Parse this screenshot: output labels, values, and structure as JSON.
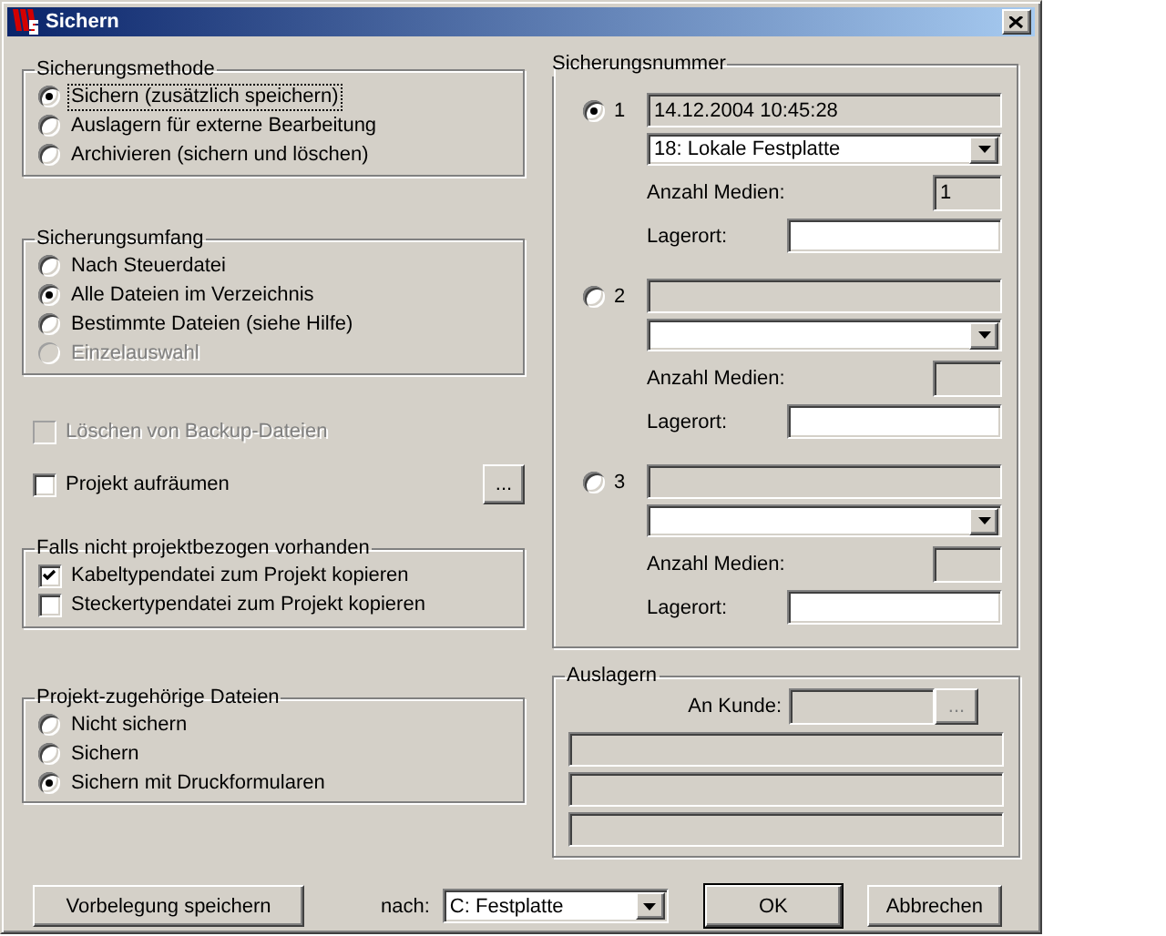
{
  "window": {
    "title": "Sichern"
  },
  "method": {
    "title": "Sicherungsmethode",
    "options": [
      {
        "label": "Sichern (zusätzlich speichern)",
        "selected": true,
        "focused": true
      },
      {
        "label": "Auslagern für externe Bearbeitung",
        "selected": false,
        "focused": false
      },
      {
        "label": "Archivieren (sichern und löschen)",
        "selected": false,
        "focused": false
      }
    ]
  },
  "scope": {
    "title": "Sicherungsumfang",
    "options": [
      {
        "label": "Nach Steuerdatei",
        "selected": false,
        "disabled": false
      },
      {
        "label": "Alle Dateien im Verzeichnis",
        "selected": true,
        "disabled": false
      },
      {
        "label": "Bestimmte Dateien (siehe Hilfe)",
        "selected": false,
        "disabled": false
      },
      {
        "label": "Einzelauswahl",
        "selected": false,
        "disabled": true
      }
    ]
  },
  "delete_backups": {
    "label": "Löschen von Backup-Dateien",
    "checked": false,
    "disabled": true
  },
  "cleanup": {
    "label": "Projekt aufräumen",
    "checked": false,
    "disabled": false,
    "button": "..."
  },
  "if_missing": {
    "title": "Falls nicht projektbezogen vorhanden",
    "options": [
      {
        "label": "Kabeltypendatei zum Projekt kopieren",
        "checked": true
      },
      {
        "label": "Steckertypendatei zum Projekt kopieren",
        "checked": false
      }
    ]
  },
  "project_files": {
    "title": "Projekt-zugehörige Dateien",
    "options": [
      {
        "label": "Nicht sichern",
        "selected": false
      },
      {
        "label": "Sichern",
        "selected": false
      },
      {
        "label": "Sichern mit Druckformularen",
        "selected": true
      }
    ]
  },
  "backup_number": {
    "title": "Sicherungsnummer",
    "slots": [
      {
        "number": "1",
        "selected": true,
        "timestamp": "14.12.2004 10:45:28",
        "medium": "18: Lokale Festplatte",
        "media_count_label": "Anzahl Medien:",
        "media_count": "1",
        "location_label": "Lagerort:"
      },
      {
        "number": "2",
        "selected": false,
        "media_count_label": "Anzahl Medien:",
        "location_label": "Lagerort:"
      },
      {
        "number": "3",
        "selected": false,
        "media_count_label": "Anzahl Medien:",
        "location_label": "Lagerort:"
      }
    ]
  },
  "export": {
    "title": "Auslagern",
    "customer_label": "An Kunde:",
    "browse_button": "..."
  },
  "footer": {
    "save_defaults_button": "Vorbelegung speichern",
    "target_label": "nach:",
    "target": "C: Festplatte",
    "ok_button": "OK",
    "cancel_button": "Abbrechen"
  }
}
